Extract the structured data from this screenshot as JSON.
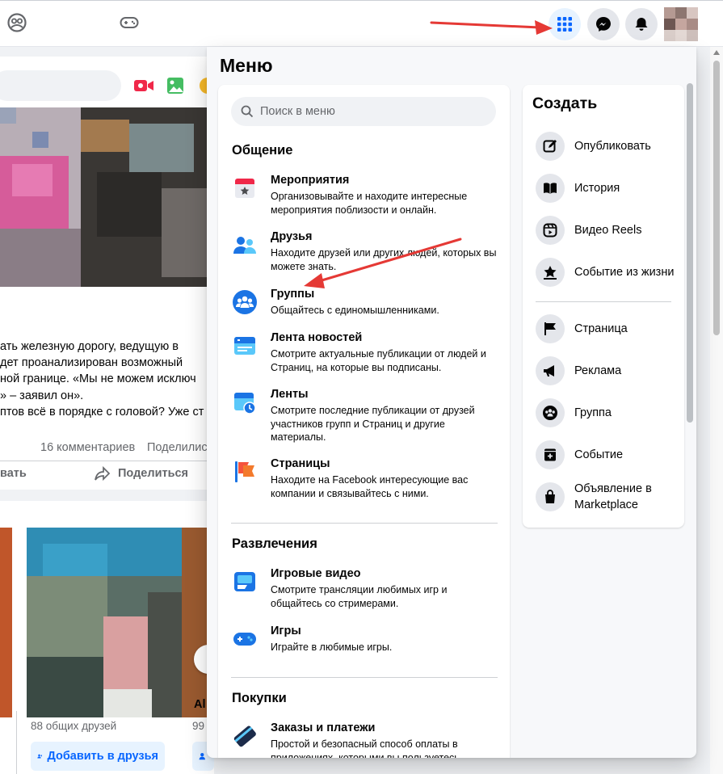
{
  "topbar": {
    "icons": [
      "groups-icon",
      "gaming-icon",
      "apps-grid-icon",
      "messenger-icon",
      "notifications-bell-icon",
      "profile-avatar"
    ],
    "accent": "#0866ff"
  },
  "feed": {
    "post_lines": [
      "ать железную дорогу, ведущую в",
      "дет проанализирован возможный",
      "ной границе. «Мы не можем исключ",
      "» – заявил он».",
      "птов всё в порядке с головой? Уже ст"
    ],
    "comments": "16 комментариев",
    "shares_partial": "Поделилис",
    "like_partial": "вать",
    "share_label": "Поделиться",
    "mutual_friends": "88 общих друзей",
    "mutual_friends_2": "99",
    "add_friend": "Добавить в друзья",
    "add_friend_2": "До",
    "partial_name": "Al"
  },
  "menu": {
    "title": "Меню",
    "search_placeholder": "Поиск в меню",
    "sections": [
      {
        "title": "Общение",
        "items": [
          {
            "title": "Мероприятия",
            "desc": "Организовывайте и находите интересные мероприятия поблизости и онлайн.",
            "icon": "events-calendar-icon"
          },
          {
            "title": "Друзья",
            "desc": "Находите друзей или других людей, которых вы можете знать.",
            "icon": "friends-icon"
          },
          {
            "title": "Группы",
            "desc": "Общайтесь с единомышленниками.",
            "icon": "groups-icon"
          },
          {
            "title": "Лента новостей",
            "desc": "Смотрите актуальные публикации от людей и Страниц, на которые вы подписаны.",
            "icon": "news-feed-icon"
          },
          {
            "title": "Ленты",
            "desc": "Смотрите последние публикации от друзей участников групп и Страниц и другие материалы.",
            "icon": "feeds-clock-icon"
          },
          {
            "title": "Страницы",
            "desc": "Находите на Facebook интересующие вас компании и связывайтесь с ними.",
            "icon": "pages-flag-icon"
          }
        ]
      },
      {
        "title": "Развлечения",
        "items": [
          {
            "title": "Игровые видео",
            "desc": "Смотрите трансляции любимых игр и общайтесь со стримерами.",
            "icon": "gaming-video-icon"
          },
          {
            "title": "Игры",
            "desc": "Играйте в любимые игры.",
            "icon": "games-controller-icon"
          }
        ]
      },
      {
        "title": "Покупки",
        "items": [
          {
            "title": "Заказы и платежи",
            "desc": "Простой и безопасный способ оплаты в приложениях, которыми вы пользуетесь.",
            "icon": "payment-card-icon"
          }
        ]
      }
    ]
  },
  "create": {
    "title": "Создать",
    "items": [
      {
        "label": "Опубликовать",
        "icon": "compose-icon"
      },
      {
        "label": "История",
        "icon": "story-book-icon"
      },
      {
        "label": "Видео Reels",
        "icon": "reels-icon"
      },
      {
        "label": "Событие из жизни",
        "icon": "life-event-star-icon"
      },
      {
        "label": "Страница",
        "icon": "page-flag-icon"
      },
      {
        "label": "Реклама",
        "icon": "ad-megaphone-icon"
      },
      {
        "label": "Группа",
        "icon": "group-icon"
      },
      {
        "label": "Событие",
        "icon": "event-plus-icon"
      },
      {
        "label": "Объявление в Marketplace",
        "icon": "marketplace-bag-icon"
      }
    ]
  },
  "annotations": {
    "arrow_color": "#e53935"
  }
}
